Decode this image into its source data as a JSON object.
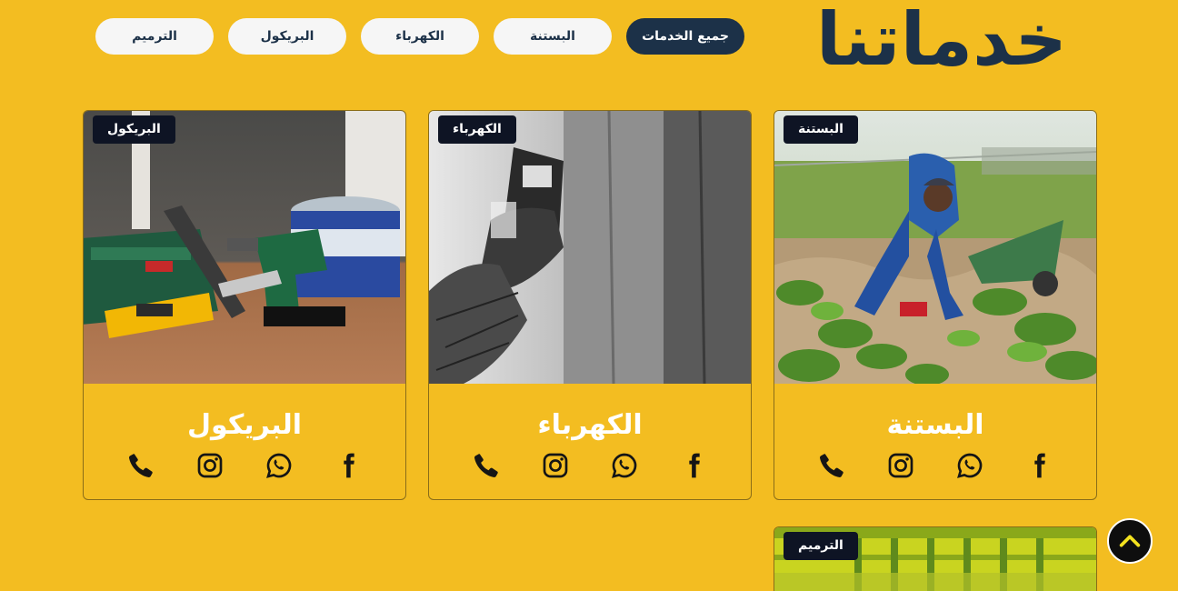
{
  "page": {
    "title": "خدماتنا"
  },
  "filters": [
    {
      "label": "جميع الخدمات",
      "active": true
    },
    {
      "label": "البستنة",
      "active": false
    },
    {
      "label": "الكهرباء",
      "active": false
    },
    {
      "label": "البريكول",
      "active": false
    },
    {
      "label": "الترميم",
      "active": false
    }
  ],
  "cards": [
    {
      "badge": "البستنة",
      "title": "البستنة",
      "image": "gardener-planting-photo",
      "icons": [
        "phone-icon",
        "instagram-icon",
        "whatsapp-icon",
        "facebook-icon"
      ]
    },
    {
      "badge": "الكهرباء",
      "title": "الكهرباء",
      "image": "electrician-meter-photo",
      "icons": [
        "phone-icon",
        "instagram-icon",
        "whatsapp-icon",
        "facebook-icon"
      ]
    },
    {
      "badge": "البريكول",
      "title": "البريكول",
      "image": "tools-drill-hammer-photo",
      "icons": [
        "phone-icon",
        "instagram-icon",
        "whatsapp-icon",
        "facebook-icon"
      ]
    },
    {
      "badge": "الترميم",
      "title": "",
      "image": "renovation-wall-photo",
      "icons": []
    }
  ],
  "scroll_top": {
    "icon": "chevron-up-icon"
  },
  "colors": {
    "background": "#f3bd21",
    "navy": "#1c3148",
    "badge": "#0e1424",
    "card_title": "#ffffff",
    "filter_bg": "#f6f6f6",
    "scroll_top_chevron": "#f3e21f"
  }
}
